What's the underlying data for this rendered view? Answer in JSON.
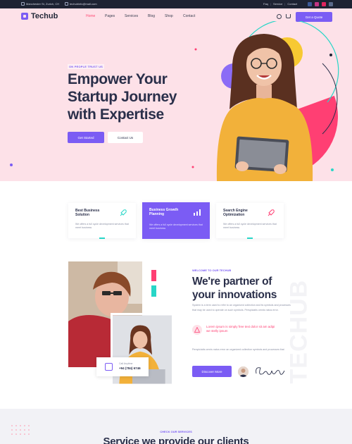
{
  "topbar": {
    "address": "Manchester St, Zurich, CH",
    "email": "techubinfo@mail.com",
    "links": [
      "Faq",
      "Service",
      "Contact"
    ],
    "socials": [
      "facebook-icon",
      "instagram-icon",
      "twitter-icon",
      "linkedin-icon"
    ]
  },
  "nav": {
    "logo": "Techub",
    "menu": [
      "Home",
      "Pages",
      "Services",
      "Blog",
      "Shop",
      "Contact"
    ],
    "quote_button": "Get a Quote"
  },
  "hero": {
    "tag": "ON PEOPLE TRUST US",
    "title": "Empower Your Startup Journey with Expertise",
    "primary_button": "Get Started",
    "secondary_button": "Contact Us"
  },
  "features": [
    {
      "title": "Best Business Solution",
      "desc": "We offers a full cycle development services that meet business",
      "icon": "rocket-icon"
    },
    {
      "title": "Business Growth Planning",
      "desc": "We offers a full cycle development services that meet business",
      "icon": "chart-icon"
    },
    {
      "title": "Search Engine Optimization",
      "desc": "We offers a full cycle development services that meet business",
      "icon": "rocket-icon"
    }
  ],
  "about": {
    "tag": "WELCOME TO OUR TECHUB",
    "title": "We're partner of your innovations",
    "paragraph1": "System is a term used to refer to an organized collection and its symbols and processes that may be used to operate on such symbols. Perspiciatis omnis natus error.",
    "highlight": "Lorem ipsum is simply free text dolor sit am adipi we stelly ipsum",
    "paragraph2": "Perspiciatis omnis natus error an organized collection symbols and processes that",
    "button": "Discover More",
    "call_label": "Call Anytime",
    "call_number": "+94 (784) 6746",
    "watermark": "TECHUB"
  },
  "services": {
    "tag": "CHECK OUR SERVICES",
    "title": "Service we provide our clients"
  },
  "colors": {
    "accent": "#7b5cf4",
    "pink": "#ff3f73",
    "teal": "#28d6c7",
    "yellow": "#f7c932",
    "hero_bg": "#fde1e8",
    "dark": "#1d2333"
  }
}
